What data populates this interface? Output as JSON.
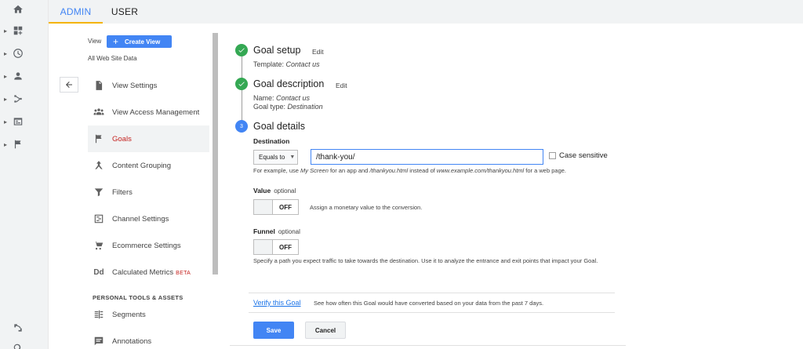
{
  "tabs": [
    {
      "label": "ADMIN",
      "active": true
    },
    {
      "label": "USER",
      "active": false
    }
  ],
  "rail": {
    "icons": [
      "home-icon",
      "dashboard-icon",
      "clock-icon",
      "person-icon",
      "acquisition-icon",
      "behavior-icon",
      "flag-icon"
    ],
    "bottom_icons": [
      "discover-icon",
      "search-icon"
    ]
  },
  "view": {
    "label": "View",
    "create_button": "Create View",
    "name": "All Web Site Data"
  },
  "nav": {
    "items": [
      {
        "label": "View Settings",
        "icon": "document-icon"
      },
      {
        "label": "View Access Management",
        "icon": "people-icon"
      },
      {
        "label": "Goals",
        "icon": "flag-icon",
        "selected": true
      },
      {
        "label": "Content Grouping",
        "icon": "content-grouping-icon"
      },
      {
        "label": "Filters",
        "icon": "filter-icon"
      },
      {
        "label": "Channel Settings",
        "icon": "channel-icon"
      },
      {
        "label": "Ecommerce Settings",
        "icon": "cart-icon"
      },
      {
        "label": "Calculated Metrics",
        "icon": "dd-icon",
        "badge": "BETA"
      }
    ],
    "section_head": "PERSONAL TOOLS & ASSETS",
    "personal_items": [
      {
        "label": "Segments",
        "icon": "segments-icon"
      },
      {
        "label": "Annotations",
        "icon": "annotation-icon"
      }
    ]
  },
  "goal": {
    "setup": {
      "title": "Goal setup",
      "edit": "Edit",
      "template_label": "Template:",
      "template_value": "Contact us"
    },
    "description": {
      "title": "Goal description",
      "edit": "Edit",
      "name_label": "Name:",
      "name_value": "Contact us",
      "type_label": "Goal type:",
      "type_value": "Destination"
    },
    "details": {
      "step_number": "3",
      "title": "Goal details",
      "destination_label": "Destination",
      "match_type": "Equals to",
      "destination_value": "/thank-you/",
      "case_sensitive_label": "Case sensitive",
      "case_sensitive_checked": false,
      "hint_parts": [
        "For example, use ",
        "My Screen",
        " for an app and ",
        "/thankyou.html",
        " instead of ",
        "www.example.com/thankyou.html",
        " for a web page."
      ],
      "value_label": "Value",
      "value_optional": "optional",
      "value_toggle": "OFF",
      "value_desc": "Assign a monetary value to the conversion.",
      "funnel_label": "Funnel",
      "funnel_optional": "optional",
      "funnel_toggle": "OFF",
      "funnel_desc": "Specify a path you expect traffic to take towards the destination. Use it to analyze the entrance and exit points that impact your Goal."
    },
    "verify": {
      "link": "Verify this Goal",
      "desc": "See how often this Goal would have converted based on your data from the past 7 days."
    },
    "save": "Save",
    "cancel": "Cancel"
  }
}
